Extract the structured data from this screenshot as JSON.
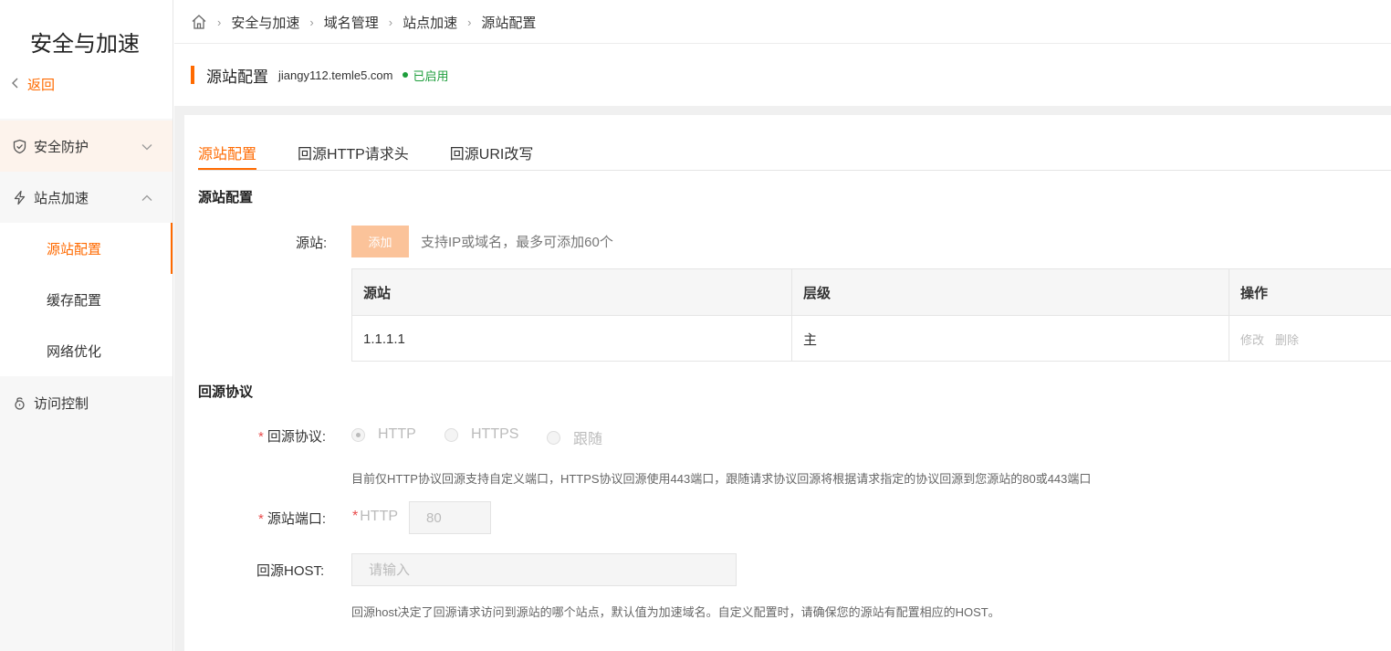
{
  "sidebar": {
    "title": "安全与加速",
    "back_label": "返回",
    "groups": [
      {
        "label": "安全防护",
        "icon": "shield-icon"
      },
      {
        "label": "站点加速",
        "icon": "lightning-icon"
      },
      {
        "label": "访问控制",
        "icon": "lock-icon"
      }
    ],
    "sub_items": [
      {
        "label": "源站配置"
      },
      {
        "label": "缓存配置"
      },
      {
        "label": "网络优化"
      }
    ]
  },
  "breadcrumb": {
    "items": [
      "安全与加速",
      "域名管理",
      "站点加速",
      "源站配置"
    ]
  },
  "header": {
    "title": "源站配置",
    "domain": "jiangy112.temle5.com",
    "status": "已启用"
  },
  "tabs": [
    {
      "label": "源站配置"
    },
    {
      "label": "回源HTTP请求头"
    },
    {
      "label": "回源URI改写"
    }
  ],
  "origin_section": {
    "title": "源站配置",
    "label": "源站:",
    "add_button": "添加",
    "hint": "支持IP或域名，最多可添加60个",
    "table": {
      "headers": [
        "源站",
        "层级",
        "操作"
      ],
      "rows": [
        {
          "origin": "1.1.1.1",
          "level": "主",
          "actions": [
            "修改",
            "删除"
          ]
        }
      ]
    }
  },
  "protocol_section": {
    "title": "回源协议",
    "protocol_label": "回源协议:",
    "options": [
      "HTTP",
      "HTTPS",
      "跟随"
    ],
    "selected": "HTTP",
    "protocol_help": "目前仅HTTP协议回源支持自定义端口，HTTPS协议回源使用443端口，跟随请求协议回源将根据请求指定的协议回源到您源站的80或443端口",
    "port_label": "源站端口:",
    "port_prefix": "HTTP",
    "port_value": "80",
    "host_label": "回源HOST:",
    "host_placeholder": "请输入",
    "host_help": "回源host决定了回源请求访问到源站的哪个站点，默认值为加速域名。自定义配置时，请确保您的源站有配置相应的HOST。"
  },
  "colors": {
    "accent": "#ff6a00",
    "success": "#1e9e3c"
  }
}
